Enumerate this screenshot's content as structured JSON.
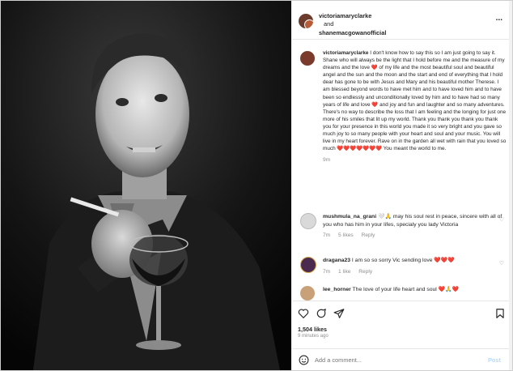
{
  "header": {
    "user1": "victoriamaryclarke",
    "and": "and",
    "user2": "shanemacgowanofficial",
    "more": "..."
  },
  "caption": {
    "username": "victoriamaryclarke",
    "text": "I don't know how to say this so I am just going to say it. Shane who will always be the light that I hold before me and the measure of my dreams and the love ❤️ of my life and the most beautiful soul and beautiful angel and the sun and the moon and the start and end of everything that I hold dear has gone to be with Jesus and Mary and his beautiful mother Therese. I am blessed beyond words to have met him and to have loved him and to have been so endlessly and unconditionally loved by him and to have had so many years of life and love ❤️ and joy and fun and laughter and so many adventures. There's no way to describe the loss that I am feeling and the longing for just one more of his smiles that lit up my world. Thank you thank you thank you thank you for your presence in this world you made it so very bright and you gave so much joy to so many people with your heart and soul and your music. You will live in my heart forever. Rave on in the garden all wet with rain that you loved so much ❤️❤️❤️❤️❤️❤️❤️ You meant the world to me.",
    "time": "9m"
  },
  "comments": [
    {
      "username": "mushmula_na_grani",
      "text": "🤍🙏 may his soul rest in peace, sincere with all of you who has him in your lifes, specialy you lady Victoria",
      "time": "7m",
      "likes": "5 likes",
      "reply": "Reply"
    },
    {
      "username": "dragana23",
      "text": "I am so so sorry Vic sending love ❤️❤️❤️",
      "time": "7m",
      "likes": "1 like",
      "reply": "Reply"
    },
    {
      "username": "lee_horner",
      "text": "The love of your life heart and soul ❤️🙏❤️",
      "time": "",
      "likes": "",
      "reply": ""
    }
  ],
  "actions": {
    "likes": "1,504 likes",
    "time": "9 minutes ago"
  },
  "add_comment": {
    "placeholder": "Add a comment...",
    "post": "Post"
  },
  "icons": [
    "heart-icon",
    "comment-icon",
    "share-icon",
    "bookmark-icon",
    "emoji-icon",
    "more-icon"
  ]
}
